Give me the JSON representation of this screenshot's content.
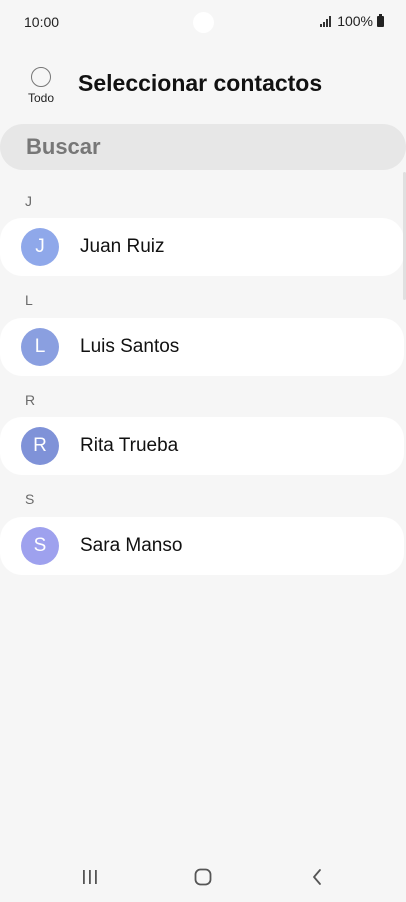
{
  "status_bar": {
    "time": "10:00",
    "battery": "100%"
  },
  "header": {
    "select_all_label": "Todo",
    "title": "Seleccionar contactos"
  },
  "search": {
    "placeholder": "Buscar"
  },
  "sections": [
    {
      "letter": "J",
      "contacts": [
        {
          "initial": "J",
          "name": "Juan Ruiz",
          "color": "#8fa8ea"
        }
      ]
    },
    {
      "letter": "L",
      "contacts": [
        {
          "initial": "L",
          "name": "Luis Santos",
          "color": "#8a9fe0"
        }
      ]
    },
    {
      "letter": "R",
      "contacts": [
        {
          "initial": "R",
          "name": "Rita Trueba",
          "color": "#7f92d8"
        }
      ]
    },
    {
      "letter": "S",
      "contacts": [
        {
          "initial": "S",
          "name": "Sara Manso",
          "color": "#9ea1ee"
        }
      ]
    }
  ],
  "nav": {
    "recent_icon": "recent-apps-icon",
    "home_icon": "home-icon",
    "back_icon": "back-icon"
  }
}
